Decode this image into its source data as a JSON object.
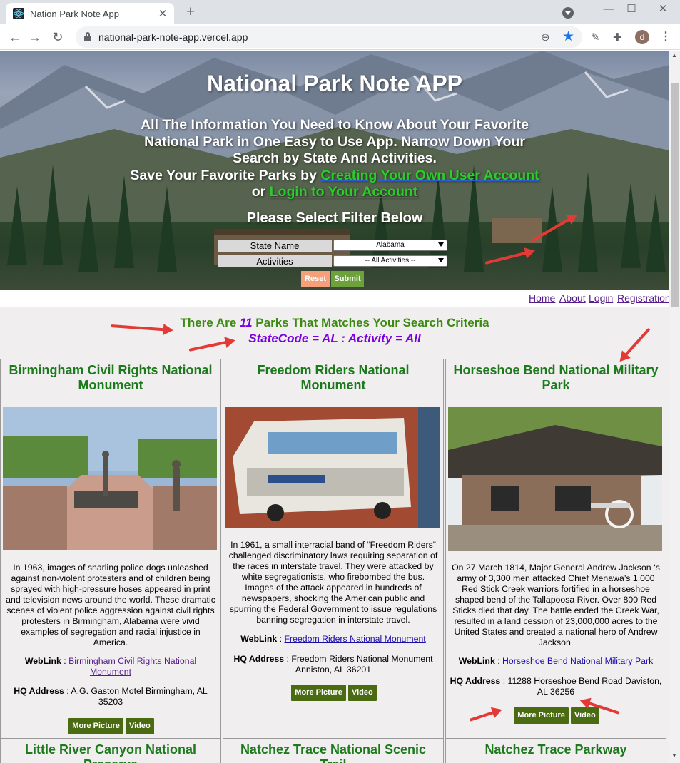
{
  "browser": {
    "tab_title": "Nation Park Note App",
    "tab_close": "✕",
    "new_tab": "+",
    "url": "national-park-note-app.vercel.app",
    "avatar_letter": "d",
    "icons": [
      "react-favicon-icon",
      "back-icon",
      "forward-icon",
      "reload-icon",
      "lock-icon",
      "zoom-icon",
      "star-icon",
      "eyedropper-icon",
      "puzzle-icon",
      "menu-icon"
    ]
  },
  "hero": {
    "title": "National Park Note APP",
    "desc_part1": "All The Information You Need to Know About Your Favorite National Park in One Easy to Use App. Narrow Down Your Search by State And Activities.",
    "desc_part2": "Save Your Favorite Parks by ",
    "link_create": "Creating Your Own User Account",
    "desc_or": " or ",
    "link_login": "Login to Your Account",
    "filter_heading": "Please Select Filter Below",
    "state_label": "State Name",
    "state_value": "Alabama",
    "activities_label": "Activities",
    "activities_value": "-- All Activities --",
    "reset_label": "Reset",
    "submit_label": "Submit"
  },
  "nav": {
    "home": "Home",
    "about": "About",
    "login": "Login",
    "registration": "Registration"
  },
  "results": {
    "prefix": "There Are ",
    "count": "11",
    "suffix": " Parks That Matches Your Search Criteria",
    "criteria": "StateCode = AL : Activity = All"
  },
  "labels": {
    "weblink": "WebLink",
    "hq_address": "HQ Address",
    "sep": " : ",
    "more_picture": "More Picture",
    "video": "Video"
  },
  "parks": [
    {
      "title": "Birmingham Civil Rights National Monument",
      "description": "In 1963, images of snarling police dogs unleashed against non-violent protesters and of children being sprayed with high-pressure hoses appeared in print and television news around the world. These dramatic scenes of violent police aggression against civil rights protesters in Birmingham, Alabama were vivid examples of segregation and racial injustice in America.",
      "weblink": "Birmingham Civil Rights National Monument",
      "hq": "A.G. Gaston Motel Birmingham, AL 35203"
    },
    {
      "title": "Freedom Riders National Monument",
      "description": "In 1961, a small interracial band of “Freedom Riders” challenged discriminatory laws requiring separation of the races in interstate travel. They were attacked by white segregationists, who firebombed the bus. Images of the attack appeared in hundreds of newspapers, shocking the American public and spurring the Federal Government to issue regulations banning segregation in interstate travel.",
      "weblink": "Freedom Riders National Monument",
      "hq": "Freedom Riders National Monument Anniston, AL 36201"
    },
    {
      "title": "Horseshoe Bend National Military Park",
      "description": "On 27 March 1814, Major General Andrew Jackson ‘s army of 3,300 men attacked Chief Menawa’s 1,000 Red Stick Creek warriors fortified in a horseshoe shaped bend of the Tallapoosa River. Over 800 Red Sticks died that day. The battle ended the Creek War, resulted in a land cession of 23,000,000 acres to the United States and created a national hero of Andrew Jackson.",
      "weblink": "Horseshoe Bend National Military Park",
      "hq": "11288 Horseshoe Bend Road Daviston, AL 36256"
    },
    {
      "title": "Little River Canyon National Preserve"
    },
    {
      "title": "Natchez Trace National Scenic Trail"
    },
    {
      "title": "Natchez Trace Parkway"
    }
  ],
  "colors": {
    "title_green": "#1c7a1c",
    "results_green": "#3c8a12",
    "criteria_purple": "#7a00e0",
    "button_green": "#4a6b12",
    "reset_orange": "#f4a07a",
    "submit_green": "#6ca13b",
    "annotation_red": "#e43a36"
  }
}
